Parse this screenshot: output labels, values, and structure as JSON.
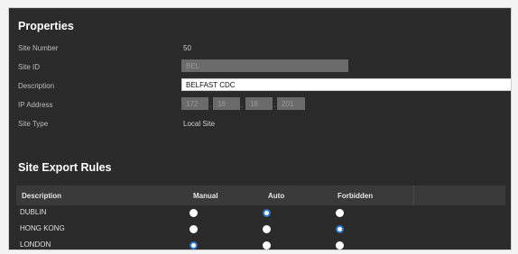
{
  "properties": {
    "title": "Properties",
    "site_number": {
      "label": "Site Number",
      "value": "50"
    },
    "site_id": {
      "label": "Site ID",
      "value": "BEL"
    },
    "description": {
      "label": "Description",
      "value": "BELFAST CDC"
    },
    "ip_address": {
      "label": "IP Address",
      "octets": [
        "172",
        "16",
        "18",
        "201"
      ]
    },
    "site_type": {
      "label": "Site Type",
      "value": "Local Site"
    }
  },
  "export_rules": {
    "title": "Site Export Rules",
    "columns": [
      "Description",
      "Manual",
      "Auto",
      "Forbidden"
    ],
    "rows": [
      {
        "name": "DUBLIN",
        "selected": "Auto"
      },
      {
        "name": "HONG KONG",
        "selected": "Forbidden"
      },
      {
        "name": "LONDON",
        "selected": "Manual"
      }
    ]
  },
  "colors": {
    "panel_bg": "#2b2b2b",
    "header_bg": "#3a3a3a",
    "radio_accent": "#2f74c9"
  }
}
